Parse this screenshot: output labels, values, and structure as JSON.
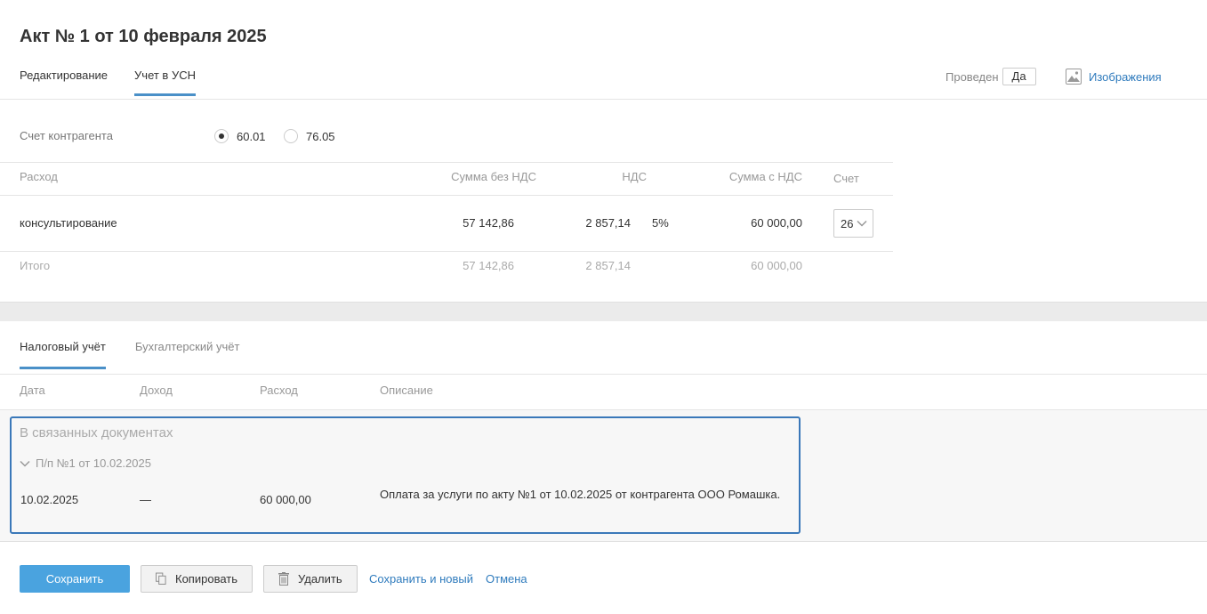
{
  "page": {
    "title": "Акт № 1 от 10 февраля 2025"
  },
  "tabs_top": [
    {
      "label": "Редактирование"
    },
    {
      "label": "Учет в УСН"
    }
  ],
  "status": {
    "label": "Проведен",
    "value": "Да"
  },
  "images_link": {
    "label": "Изображения",
    "icon": "image-icon"
  },
  "counterparty_account": {
    "label": "Счет контрагента",
    "options": [
      "60.01",
      "76.05"
    ],
    "selected": "60.01"
  },
  "expense_table": {
    "headers": {
      "expense": "Расход",
      "sum_no_vat": "Сумма без НДС",
      "vat": "НДС",
      "sum_with_vat": "Сумма с НДС",
      "account": "Счет"
    },
    "rows": [
      {
        "expense": "консультирование",
        "sum_no_vat": "57 142,86",
        "vat": "2 857,14",
        "vat_rate": "5%",
        "sum_with_vat": "60 000,00",
        "account": "26"
      }
    ],
    "total": {
      "label": "Итого",
      "sum_no_vat": "57 142,86",
      "vat": "2 857,14",
      "sum_with_vat": "60 000,00"
    }
  },
  "tabs_bottom": [
    {
      "label": "Налоговый учёт"
    },
    {
      "label": "Бухгалтерский учёт"
    }
  ],
  "ledger": {
    "headers": {
      "date": "Дата",
      "income": "Доход",
      "expense": "Расход",
      "description": "Описание"
    },
    "linked_title": "В связанных документах",
    "linked_doc": "П/п №1 от 10.02.2025",
    "entries": [
      {
        "date": "10.02.2025",
        "income": "—",
        "expense": "60 000,00",
        "description": "Оплата за услуги по акту №1 от 10.02.2025 от контрагента ООО Ромашка."
      }
    ]
  },
  "footer": {
    "save": "Сохранить",
    "copy": "Копировать",
    "delete": "Удалить",
    "save_new": "Сохранить и новый",
    "cancel": "Отмена"
  },
  "colors": {
    "accent": "#4a90c8",
    "primary_button": "#4aa3df",
    "link": "#2f7bbd",
    "selection_border": "#3a78b9"
  }
}
